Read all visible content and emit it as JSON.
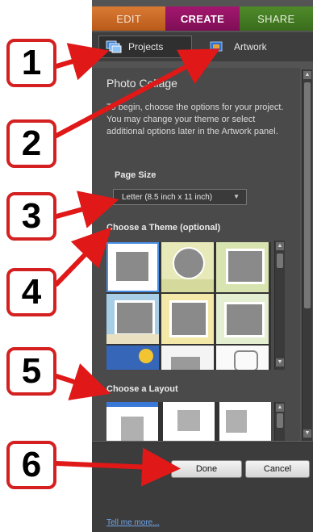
{
  "tabs": [
    {
      "label": "EDIT"
    },
    {
      "label": "CREATE"
    },
    {
      "label": "SHARE"
    }
  ],
  "subtabs": {
    "projects": "Projects",
    "artwork": "Artwork"
  },
  "panel": {
    "title": "Photo Collage",
    "intro": "To begin, choose the options for your project. You may change your theme or select additional options later in the Artwork panel.",
    "page_size_label": "Page Size",
    "page_size_value": "Letter (8.5 inch x 11 inch)",
    "theme_label": "Choose a Theme (optional)",
    "layout_label": "Choose a Layout"
  },
  "buttons": {
    "done": "Done",
    "cancel": "Cancel"
  },
  "link": "Tell me more...",
  "callouts": [
    "1",
    "2",
    "3",
    "4",
    "5",
    "6"
  ],
  "icons": {
    "projects": "projects-icon",
    "artwork": "artwork-icon"
  },
  "colors": {
    "edit": "#c96a28",
    "create": "#8e1262",
    "share": "#447c24",
    "callout_border": "#d42020",
    "arrow": "#e01818",
    "link": "#6fa4e8"
  }
}
